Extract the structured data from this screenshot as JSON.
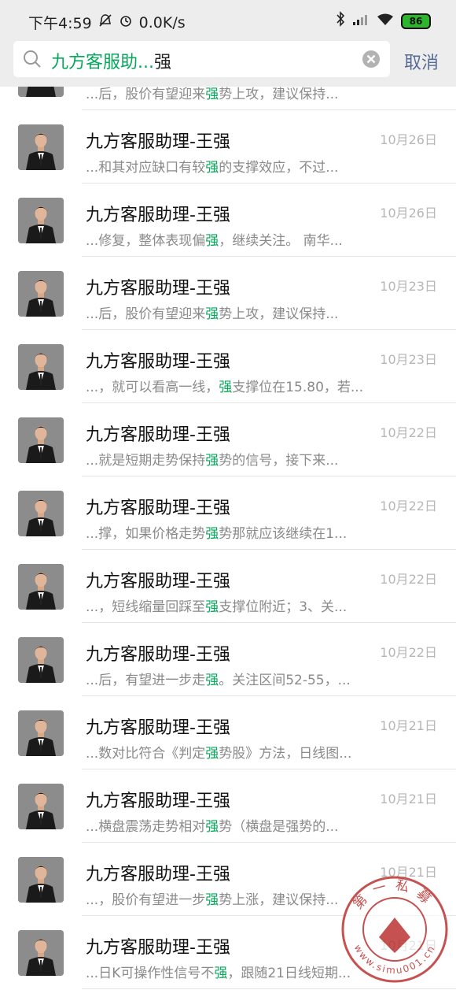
{
  "status_bar": {
    "time": "下午4:59",
    "speed": "0.0K/s",
    "battery": "86"
  },
  "search": {
    "query_highlight": "九方客服助...",
    "query_rest": "强",
    "cancel_label": "取消"
  },
  "partial_row": {
    "pre": "...后，股价有望迎来",
    "hl": "强",
    "post": "势上攻，建议保持..."
  },
  "rows": [
    {
      "name": "九方客服助理-王强",
      "date": "10月26日",
      "pre": "...和其对应缺口有较",
      "hl": "强",
      "post": "的支撑效应，不过..."
    },
    {
      "name": "九方客服助理-王强",
      "date": "10月26日",
      "pre": "...修复，整体表现偏",
      "hl": "强",
      "post": "，继续关注。  南华..."
    },
    {
      "name": "九方客服助理-王强",
      "date": "10月23日",
      "pre": "...后，股价有望迎来",
      "hl": "强",
      "post": "势上攻，建议保持..."
    },
    {
      "name": "九方客服助理-王强",
      "date": "10月23日",
      "pre": "...，就可以看高一线，",
      "hl": "强",
      "post": "支撑位在15.80，若..."
    },
    {
      "name": "九方客服助理-王强",
      "date": "10月22日",
      "pre": "...就是短期走势保持",
      "hl": "强",
      "post": "势的信号，接下来..."
    },
    {
      "name": "九方客服助理-王强",
      "date": "10月22日",
      "pre": "...撑，如果价格走势",
      "hl": "强",
      "post": "势那就应该继续在1..."
    },
    {
      "name": "九方客服助理-王强",
      "date": "10月22日",
      "pre": "...，短线缩量回踩至",
      "hl": "强",
      "post": "支撑位附近；3、关..."
    },
    {
      "name": "九方客服助理-王强",
      "date": "10月22日",
      "pre": "...后，有望进一步走",
      "hl": "强",
      "post": "。关注区间52-55，..."
    },
    {
      "name": "九方客服助理-王强",
      "date": "10月21日",
      "pre": "...数对比符合《判定",
      "hl": "强",
      "post": "势股》方法，日线图..."
    },
    {
      "name": "九方客服助理-王强",
      "date": "10月21日",
      "pre": "...横盘震荡走势相对",
      "hl": "强",
      "post": "势（横盘是强势的..."
    },
    {
      "name": "九方客服助理-王强",
      "date": "10月21日",
      "pre": "...，股价有望进一步",
      "hl": "强",
      "post": "势上涨，建议保持..."
    },
    {
      "name": "九方客服助理-王强",
      "date": "10月21日",
      "pre": "...日K可操作性信号不",
      "hl": "强",
      "post": "，跟随21日线短期..."
    }
  ],
  "watermark": {
    "text_top": "第一私募",
    "text_bottom": "www.simu001.cn"
  }
}
